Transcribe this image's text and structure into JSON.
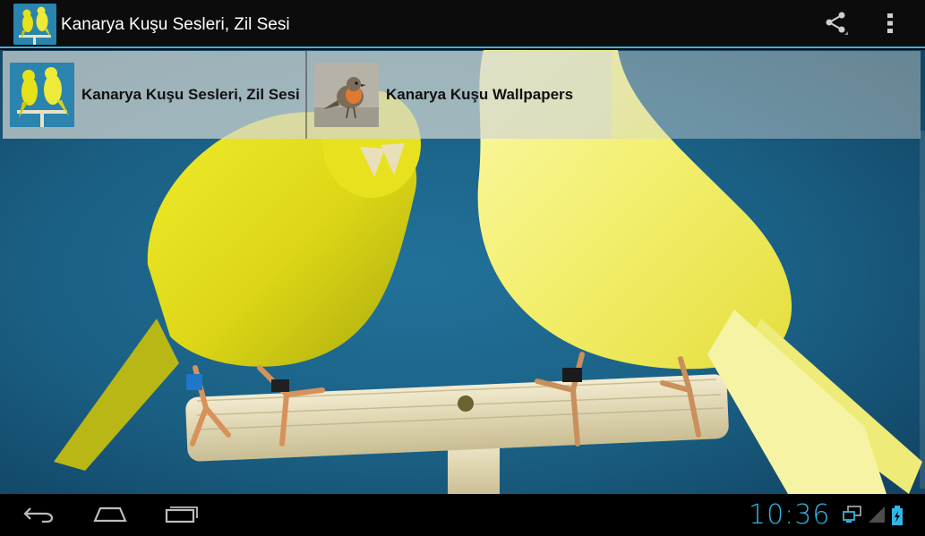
{
  "app": {
    "title": "Kanarya Kuşu Sesleri, Zil Sesi",
    "accent_color": "#33b5e5"
  },
  "action_bar": {
    "share_icon": "share-icon",
    "overflow_icon": "overflow-menu-icon"
  },
  "promos": [
    {
      "label": "Kanarya Kuşu Sesleri, Zil Sesi",
      "icon": "canary-thumbnail"
    },
    {
      "label": "Kanarya Kuşu Wallpapers",
      "icon": "robin-thumbnail"
    }
  ],
  "content": {
    "image": "two-yellow-canaries-on-perch"
  },
  "system_bar": {
    "clock": "10:36",
    "back_icon": "back-icon",
    "home_icon": "home-icon",
    "recent_icon": "recent-apps-icon",
    "status_icons": [
      "network-icon",
      "signal-icon",
      "battery-charging-icon"
    ]
  }
}
